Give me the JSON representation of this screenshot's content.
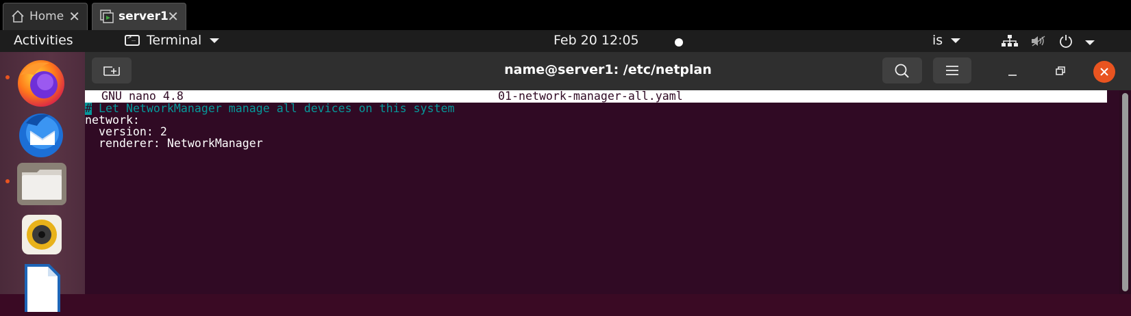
{
  "host_tabs": [
    {
      "label": "Home",
      "icon": "home-icon",
      "close": "✕"
    },
    {
      "label": "server1",
      "icon": "vm-icon",
      "close": "✕"
    }
  ],
  "panel": {
    "activities": "Activities",
    "app_menu": "Terminal",
    "clock": "Feb 20  12:05",
    "language": "is",
    "icons": [
      "network-icon",
      "volume-muted-icon",
      "power-icon",
      "chevron-down-icon"
    ]
  },
  "dock": {
    "items": [
      "firefox-icon",
      "thunderbird-icon",
      "files-icon",
      "rhythmbox-icon",
      "libreoffice-writer-icon"
    ],
    "accent": "#e95420"
  },
  "window": {
    "title": "name@server1: /etc/netplan",
    "buttons": [
      "new-tab-icon",
      "search-icon",
      "hamburger-menu-icon",
      "minimize-icon",
      "maximize-icon",
      "close-icon"
    ]
  },
  "nano": {
    "version": "GNU nano 4.8",
    "filename": "01-network-manager-all.yaml",
    "cursor_char": "#",
    "comment": " Let NetworkManager manage all devices on this system",
    "lines": [
      "network:",
      "  version: 2",
      "  renderer: NetworkManager"
    ]
  },
  "colors": {
    "terminal_bg": "#300a24",
    "comment": "#06989a",
    "close_button": "#e95420"
  }
}
